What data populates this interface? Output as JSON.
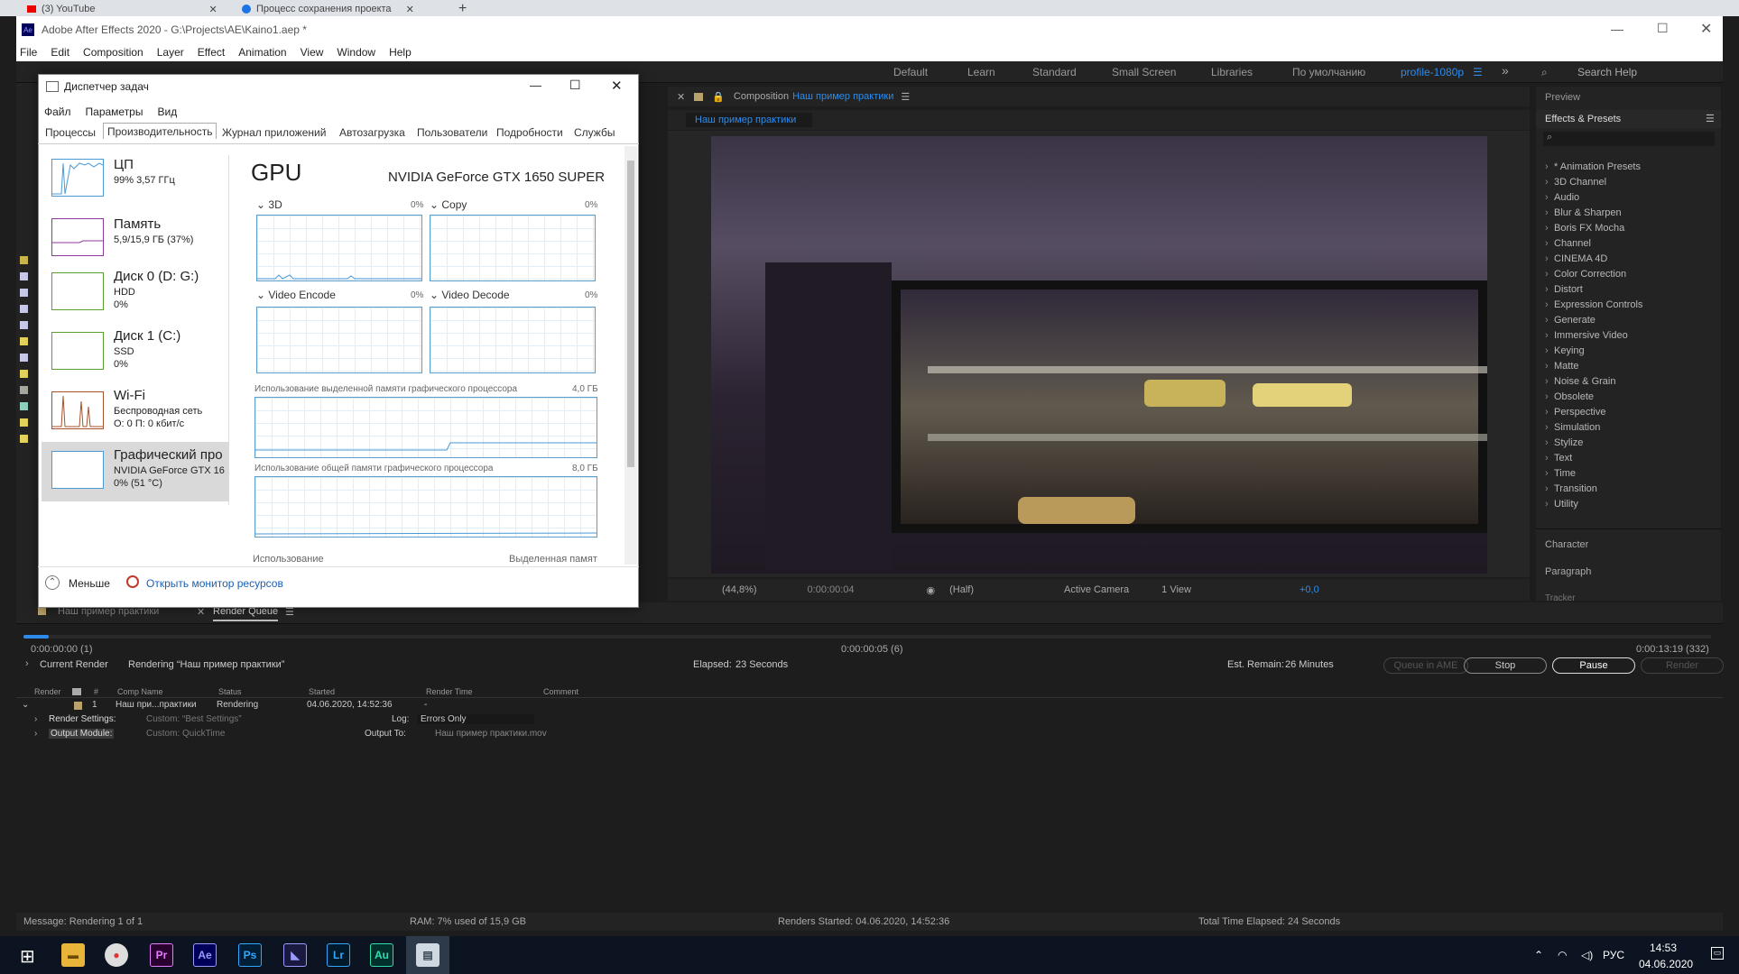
{
  "browser": {
    "tab1": "(3) YouTube",
    "tab2": "Процесс сохранения проекта"
  },
  "ae": {
    "title": "Adobe After Effects 2020 - G:\\Projects\\AE\\Kaino1.aep *",
    "menu": [
      "File",
      "Edit",
      "Composition",
      "Layer",
      "Effect",
      "Animation",
      "View",
      "Window",
      "Help"
    ],
    "workspaces": [
      "Default",
      "Learn",
      "Standard",
      "Small Screen",
      "Libraries",
      "По умолчанию",
      "profile-1080p"
    ],
    "search_help": "Search Help",
    "comp_label": "Composition",
    "comp_name": "Наш пример практики",
    "comp_tab": "Наш пример практики",
    "viewer": {
      "zoom": "(44,8%)",
      "time": "0:00:00:04",
      "resolution": "(Half)",
      "camera": "Active Camera",
      "views": "1 View",
      "exposure": "+0,0"
    }
  },
  "right_panel": {
    "preview": "Preview",
    "effects": "Effects & Presets",
    "items": [
      "* Animation Presets",
      "3D Channel",
      "Audio",
      "Blur & Sharpen",
      "Boris FX Mocha",
      "Channel",
      "CINEMA 4D",
      "Color Correction",
      "Distort",
      "Expression Controls",
      "Generate",
      "Immersive Video",
      "Keying",
      "Matte",
      "Noise & Grain",
      "Obsolete",
      "Perspective",
      "Simulation",
      "Stylize",
      "Text",
      "Time",
      "Transition",
      "Utility"
    ],
    "character": "Character",
    "paragraph": "Paragraph",
    "tracker": "Tracker"
  },
  "render_queue": {
    "tab_comp": "Наш пример практики",
    "tab_rq": "Render Queue",
    "time_start": "0:00:00:00 (1)",
    "time_mid": "0:00:00:05 (6)",
    "time_end": "0:00:13:19 (332)",
    "progress": 0.015,
    "current_render": "Current Render",
    "rendering": "Rendering “Наш пример практики”",
    "elapsed_label": "Elapsed:",
    "elapsed": "23 Seconds",
    "remain_label": "Est. Remain:",
    "remain": "26 Minutes",
    "btn_ame": "Queue in AME",
    "btn_stop": "Stop",
    "btn_pause": "Pause",
    "btn_render": "Render",
    "cols": [
      "Render",
      "#",
      "Comp Name",
      "Status",
      "Started",
      "Render Time",
      "Comment"
    ],
    "row": {
      "num": "1",
      "comp": "Наш при...практики",
      "status": "Rendering",
      "started": "04.06.2020, 14:52:36",
      "render_time": "-"
    },
    "settings_label": "Render Settings:",
    "settings_val": "Custom: “Best Settings”",
    "log_label": "Log:",
    "log_val": "Errors Only",
    "output_label": "Output Module:",
    "output_val": "Custom: QuickTime",
    "output_to_label": "Output To:",
    "output_to_val": "Наш пример практики.mov"
  },
  "status_bar": {
    "message": "Message:  Rendering 1 of 1",
    "ram": "RAM:  7% used of 15,9 GB",
    "started": "Renders Started:  04.06.2020, 14:52:36",
    "total": "Total Time Elapsed:  24 Seconds"
  },
  "task_manager": {
    "title": "Диспетчер задач",
    "menu": [
      "Файл",
      "Параметры",
      "Вид"
    ],
    "tabs": [
      "Процессы",
      "Производительность",
      "Журнал приложений",
      "Автозагрузка",
      "Пользователи",
      "Подробности",
      "Службы"
    ],
    "sidebar": [
      {
        "name": "ЦП",
        "l1": "99%  3,57 ГГц",
        "l2": ""
      },
      {
        "name": "Память",
        "l1": "5,9/15,9 ГБ (37%)",
        "l2": ""
      },
      {
        "name": "Диск 0 (D: G:)",
        "l1": "HDD",
        "l2": "0%"
      },
      {
        "name": "Диск 1 (C:)",
        "l1": "SSD",
        "l2": "0%"
      },
      {
        "name": "Wi-Fi",
        "l1": "Беспроводная сеть",
        "l2": "О: 0  П: 0 кбит/с"
      },
      {
        "name": "Графический про",
        "l1": "NVIDIA GeForce GTX 16",
        "l2": "0%  (51 °C)"
      }
    ],
    "gpu_title": "GPU",
    "gpu_name": "NVIDIA GeForce GTX 1650 SUPER",
    "graphs": [
      {
        "label": "3D",
        "pct": "0%"
      },
      {
        "label": "Copy",
        "pct": "0%"
      },
      {
        "label": "Video Encode",
        "pct": "0%"
      },
      {
        "label": "Video Decode",
        "pct": "0%"
      }
    ],
    "dedicated_label": "Использование выделенной памяти графического процессора",
    "dedicated_val": "4,0 ГБ",
    "shared_label": "Использование общей памяти графического процессора",
    "shared_val": "8,0 ГБ",
    "usage_label": "Использование",
    "dedicated_short": "Выделенная памят",
    "fewer": "Меньше",
    "monitor_link": "Открыть монитор ресурсов"
  },
  "taskbar": {
    "lang": "РУС",
    "time": "14:53",
    "date": "04.06.2020"
  }
}
